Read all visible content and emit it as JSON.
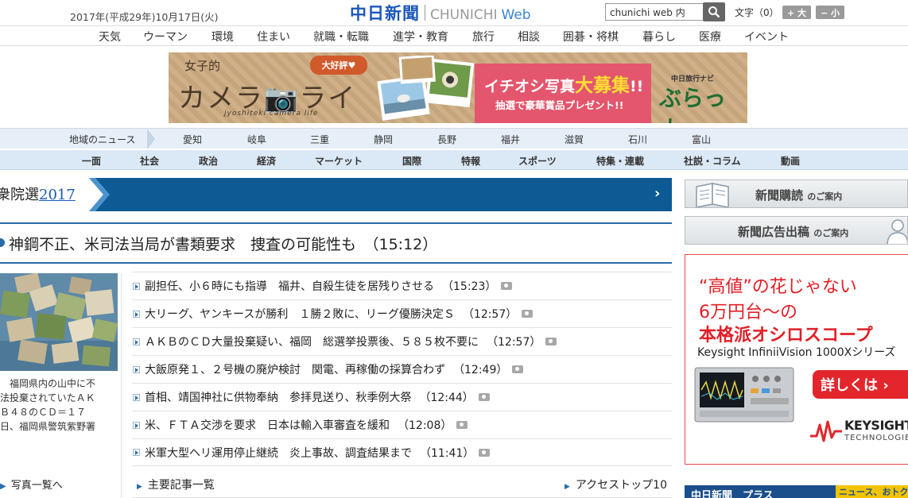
{
  "header": {
    "date": "2017年(平成29年)10月17日(火)",
    "logo_jp": "中日新聞",
    "logo_en": "CHUNICHI",
    "logo_web": "Web",
    "search_value": "chunichi web 内",
    "font_label": "文字（0）",
    "font_larger": "+ 大",
    "font_smaller": "− 小"
  },
  "genre_nav": [
    "天気",
    "ウーマン",
    "環境",
    "住まい",
    "就職・転職",
    "進学・教育",
    "旅行",
    "相談",
    "囲碁・将棋",
    "暮らし",
    "医療",
    "イベント"
  ],
  "banner": {
    "joshi": "女子的",
    "camera_life": "カメラ📷ライフ",
    "subtitle": "jyoshiteki camera life",
    "badge": "大好評♥",
    "boshu_pre": "イチオシ写真",
    "boshu_big": "大募集",
    "boshu_post": "!!",
    "present": "抽選で豪華賞品プレゼント!!",
    "navi_label": "中日旅行ナビ",
    "burra": "ぶらっ人"
  },
  "region_nav": {
    "label": "地域のニュース",
    "items": [
      "愛知",
      "岐阜",
      "三重",
      "静岡",
      "長野",
      "福井",
      "滋賀",
      "石川",
      "富山"
    ]
  },
  "section_nav": [
    "一面",
    "社会",
    "政治",
    "経済",
    "マーケット",
    "国際",
    "特報",
    "スポーツ",
    "特集・連載",
    "社説・コラム",
    "動画"
  ],
  "election": {
    "label": "衆院選",
    "year": "2017",
    "chevron": "›"
  },
  "headline": {
    "text": "神鋼不正、米司法当局が書類要求　捜査の可能性も　（15:12）"
  },
  "photo": {
    "caption": [
      "　福岡県内の山中に不",
      "法投棄されていたＡＫ",
      "Ｂ４８のＣＤ＝１７",
      "日、福岡県警筑紫野署"
    ],
    "link": "写真一覧へ"
  },
  "news": [
    {
      "title": "副担任、小６時にも指導　福井、自殺生徒を居残りさせる",
      "time": "（15:23）",
      "has_photo": true
    },
    {
      "title": "大リーグ、ヤンキースが勝利　１勝２敗に、リーグ優勝決定Ｓ",
      "time": "（12:57）",
      "has_photo": true
    },
    {
      "title": "ＡＫＢのＣＤ大量投棄疑い、福岡　総選挙投票後、５８５枚不要に",
      "time": "（12:57）",
      "has_photo": true
    },
    {
      "title": "大飯原発１、２号機の廃炉検討　関電、再稼働の採算合わず",
      "time": "（12:49）",
      "has_photo": true
    },
    {
      "title": "首相、靖国神社に供物奉納　参拝見送り、秋季例大祭",
      "time": "（12:44）",
      "has_photo": true
    },
    {
      "title": "米、ＦＴＡ交渉を要求　日本は輸入車審査を緩和",
      "time": "（12:08）",
      "has_photo": true
    },
    {
      "title": "米軍大型ヘリ運用停止継続　炎上事故、調査結果まで",
      "time": "（11:41）",
      "has_photo": true
    }
  ],
  "bottom_links": {
    "main_list": "主要記事一覧",
    "access_top": "アクセストップ10"
  },
  "sidebar": {
    "subscribe_main": "新聞購読",
    "subscribe_small": "のご案内",
    "ad_main": "新聞広告出稿",
    "ad_small": "のご案内"
  },
  "ad": {
    "line1": "“高値”の花じゃない",
    "line2": "6万円台～の",
    "line3": "本格派オシロスコープ",
    "model": "Keysight InfiniiVision 1000Xシリーズ",
    "button": "詳しくは ›",
    "brand": "KEYSIGHT",
    "brand_sub": "TECHNOLOGIES"
  },
  "plus_bar": {
    "text": "中日新聞　プラス",
    "tag": "ニュース、おトク"
  },
  "colors": {
    "brand_blue": "#1a57b8",
    "headline_blue": "#2b6aab",
    "election_blue": "#0d5a95",
    "ad_red": "#e21f26",
    "banner_pink": "#e4566d"
  }
}
